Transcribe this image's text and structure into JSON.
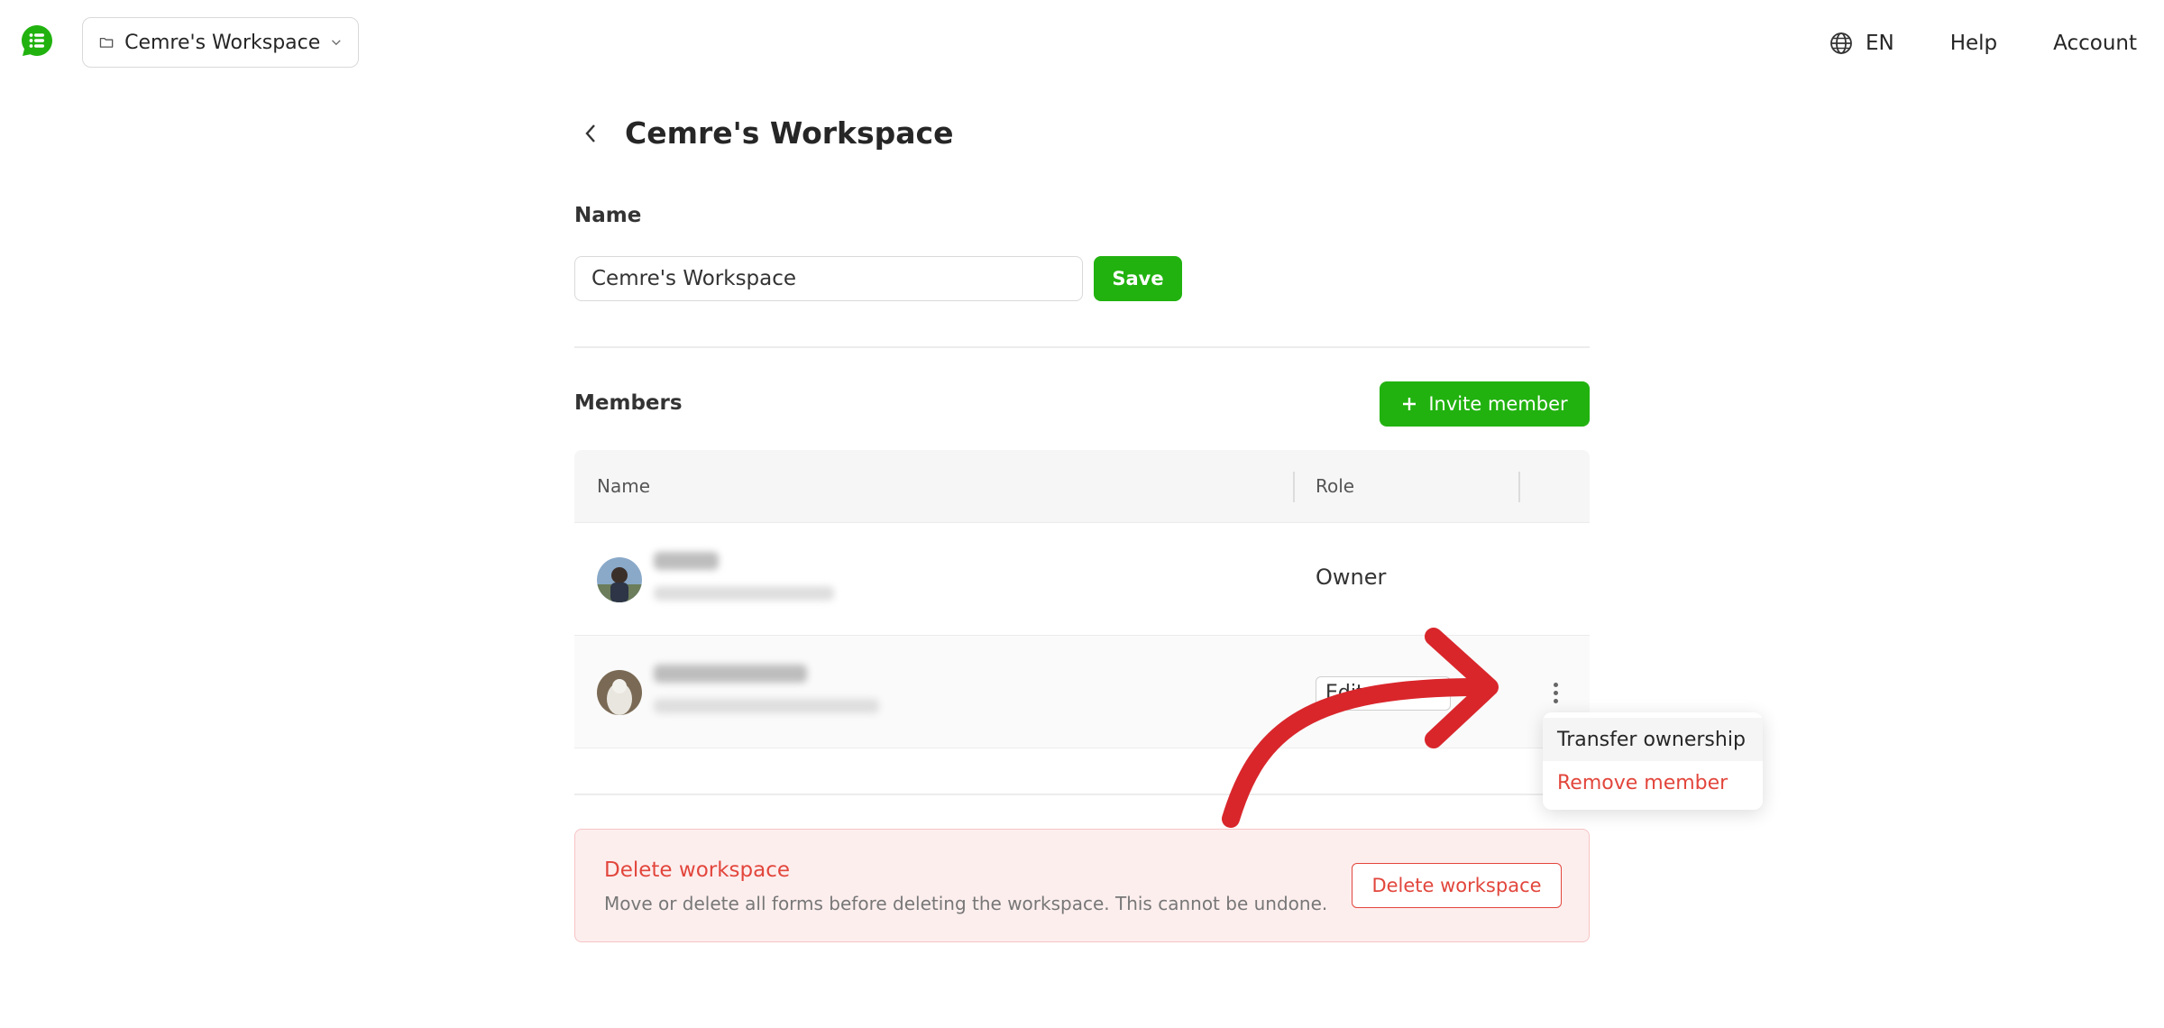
{
  "header": {
    "workspace_selector": "Cemre's Workspace",
    "language": "EN",
    "help": "Help",
    "account": "Account"
  },
  "page": {
    "title": "Cemre's Workspace",
    "name_label": "Name",
    "name_value": "Cemre's Workspace",
    "save_label": "Save"
  },
  "members": {
    "label": "Members",
    "invite_label": "Invite member",
    "columns": {
      "name": "Name",
      "role": "Role"
    },
    "rows": [
      {
        "role": "Owner"
      },
      {
        "role": "Editor"
      }
    ]
  },
  "row_menu": {
    "transfer": "Transfer ownership",
    "remove": "Remove member"
  },
  "danger_zone": {
    "title": "Delete workspace",
    "description": "Move or delete all forms before deleting the workspace. This cannot be undone.",
    "button": "Delete workspace"
  },
  "colors": {
    "brand_green": "#21b20f",
    "danger_red": "#e2463c",
    "annotation_arrow": "#d9262b"
  }
}
